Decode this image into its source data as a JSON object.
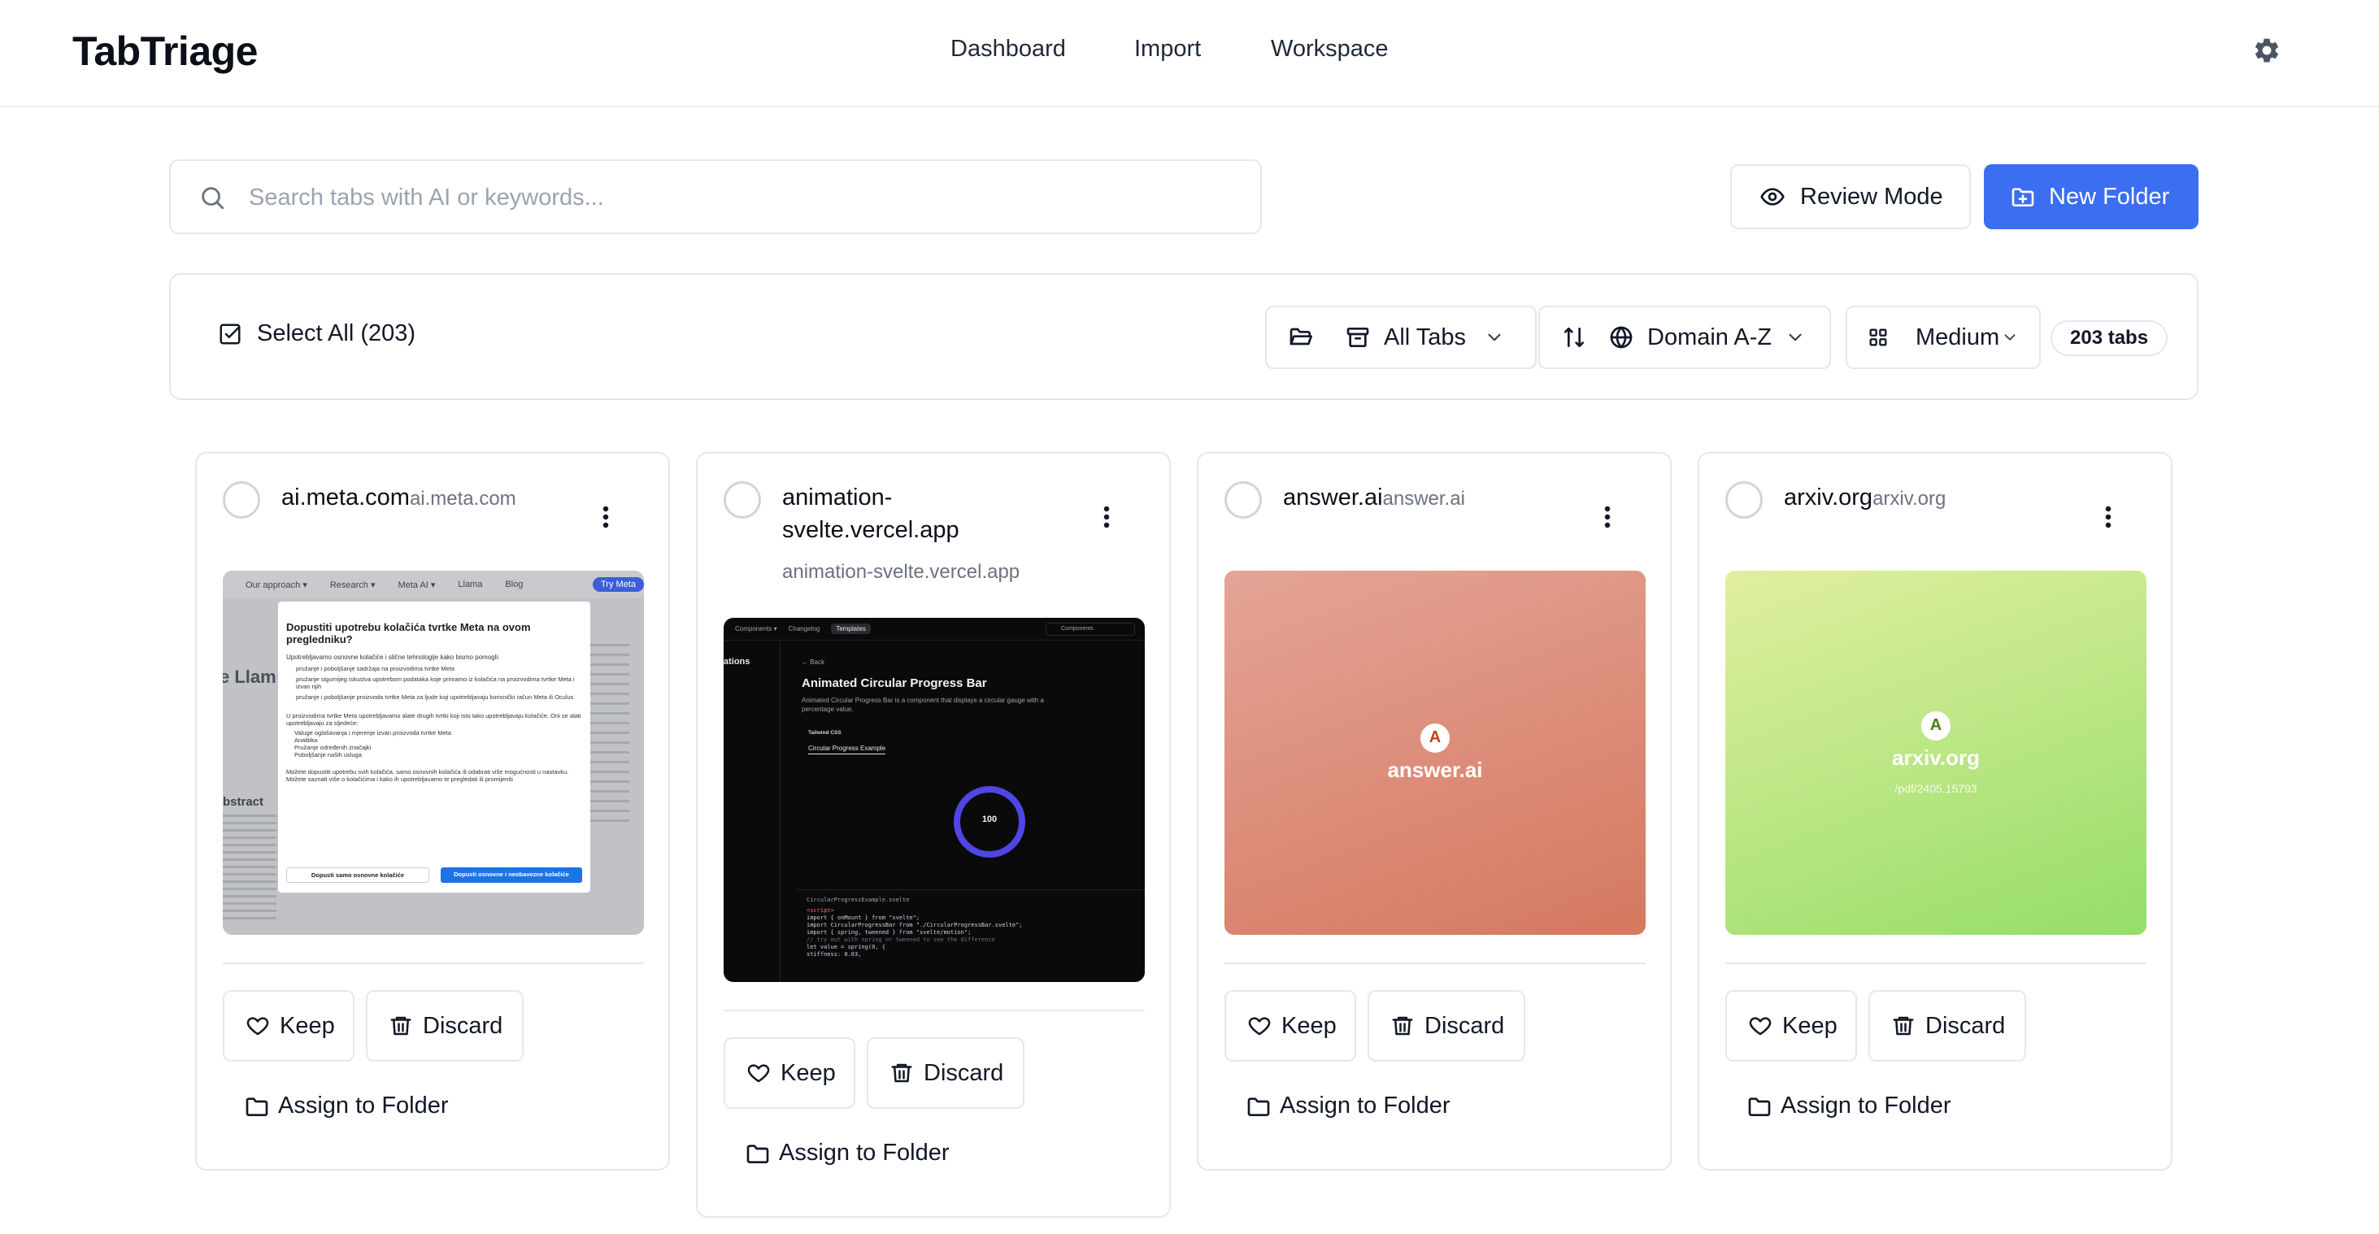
{
  "app": {
    "brand": "TabTriage",
    "nav": [
      "Dashboard",
      "Import",
      "Workspace"
    ]
  },
  "search": {
    "placeholder": "Search tabs with AI or keywords..."
  },
  "actions": {
    "review_mode": "Review Mode",
    "new_folder": "New Folder"
  },
  "toolbar": {
    "select_all": "Select All (203)",
    "folder_filter": "All Tabs",
    "sort": "Domain A-Z",
    "size": "Medium",
    "count": "203 tabs"
  },
  "cards": [
    {
      "title": "ai.meta.com",
      "subtitle": "ai.meta.com",
      "keep": "Keep",
      "discard": "Discard",
      "assign": "Assign to Folder",
      "thumb": {
        "nav": [
          "Our approach ▾",
          "Research ▾",
          "Meta AI ▾",
          "Llama",
          "Blog"
        ],
        "cta": "Try Meta",
        "left_big": "e Llam",
        "left_small": "bstract",
        "dialog_title": "Dopustiti upotrebu kolačića tvrtke Meta na ovom pregledniku?",
        "dialog_intro": "Upotrebljavamo osnovne kolačiće i slične tehnologije kako bismo pomogli:",
        "dialog_items": [
          "pružanje i poboljšanje sadržaja na proizvodima tvrtke Meta",
          "pružanje sigurnijeg iskustva upotrebom podataka koje primamo iz kolačića na proizvodima tvrtke Meta i izvan njih",
          "pružanje i poboljšanje proizvoda tvrtke Meta za ljude koji upotrebljavaju korisnički račun Meta ili Oculus"
        ],
        "dialog_para": "U proizvodima tvrtke Meta upotrebljavamo alate drugih tvrtki koji isto tako upotrebljavaju kolačiće. Oni se alati upotrebljavaju za sljedeće:",
        "dialog_list": [
          "Valuge oglašavanja i mjerenje izvan proizvoda tvrtke Meta",
          "Analitika",
          "Pružanje određenih značajki",
          "Poboljšanje naših usluga"
        ],
        "dialog_footer": "Možete dopustiti upotrebu svih kolačića, samo osnovnih kolačića ili odabrati više mogućnosti u nastavku. Možete saznati više o kolačićima i kako ih upotrebljavamo te pregledati ili promijeniti",
        "btn_essential": "Dopusti samo osnovne kolačiće",
        "btn_all": "Dopusti osnovne i neobavezne kolačiće"
      }
    },
    {
      "title": "animation-svelte.vercel.app",
      "title_line1": "animation-",
      "title_line2": "svelte.vercel.app",
      "subtitle": "animation-svelte.vercel.app",
      "keep": "Keep",
      "discard": "Discard",
      "assign": "Assign to Folder",
      "thumb": {
        "tabs": [
          "Components ▾",
          "Changelog",
          "Templates"
        ],
        "search": "Components",
        "side_label": "ations",
        "back": "← Back",
        "heading": "Animated Circular Progress Bar",
        "desc": "Animated Circular Progress Bar is a component that displays a circular gauge with a percentage value.",
        "tag": "Tailwind CSS",
        "tab": "Circular Progress Example",
        "progress": 100,
        "file": "CircularProgressExample.svelte",
        "code": [
          "<script>",
          "  import { onMount } from \"svelte\";",
          "  import CircularProgressBar from \"./CircularProgressBar.svelte\";",
          "  import { spring, tweened } from \"svelte/motion\";",
          "  // try out with spring or tweened to see the difference",
          "  let value = spring(0, {",
          "    stiffness: 0.03,"
        ]
      }
    },
    {
      "title": "answer.ai",
      "subtitle": "answer.ai",
      "keep": "Keep",
      "discard": "Discard",
      "assign": "Assign to Folder",
      "thumb": {
        "logo": "A",
        "name": "answer.ai",
        "colors": [
          "#e4a497",
          "#d5785f"
        ]
      }
    },
    {
      "title": "arxiv.org",
      "subtitle": "arxiv.org",
      "keep": "Keep",
      "discard": "Discard",
      "assign": "Assign to Folder",
      "thumb": {
        "logo": "A",
        "name": "arxiv.org",
        "path": "/pdf/2405.15793",
        "colors": [
          "#e1ef9e",
          "#95dd6a"
        ]
      }
    }
  ]
}
